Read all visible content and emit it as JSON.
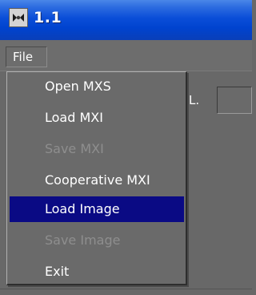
{
  "window": {
    "title": "1.1",
    "icon": "app-logo-icon"
  },
  "menubar": {
    "file_label": "File"
  },
  "background": {
    "partial_label": "L."
  },
  "file_menu": {
    "items": [
      {
        "label": "Open MXS",
        "enabled": true,
        "selected": false
      },
      {
        "label": "Load MXI",
        "enabled": true,
        "selected": false
      },
      {
        "label": "Save MXI",
        "enabled": false,
        "selected": false
      },
      {
        "label": "Cooperative MXI",
        "enabled": true,
        "selected": false
      },
      {
        "label": "Load Image",
        "enabled": true,
        "selected": true
      },
      {
        "label": "Save Image",
        "enabled": false,
        "selected": false
      },
      {
        "label": "Exit",
        "enabled": true,
        "selected": false
      }
    ]
  },
  "colors": {
    "titlebar_blue": "#0043cf",
    "selection": "#0a0a84",
    "background": "#686868",
    "disabled_text": "#8e8e8e"
  }
}
